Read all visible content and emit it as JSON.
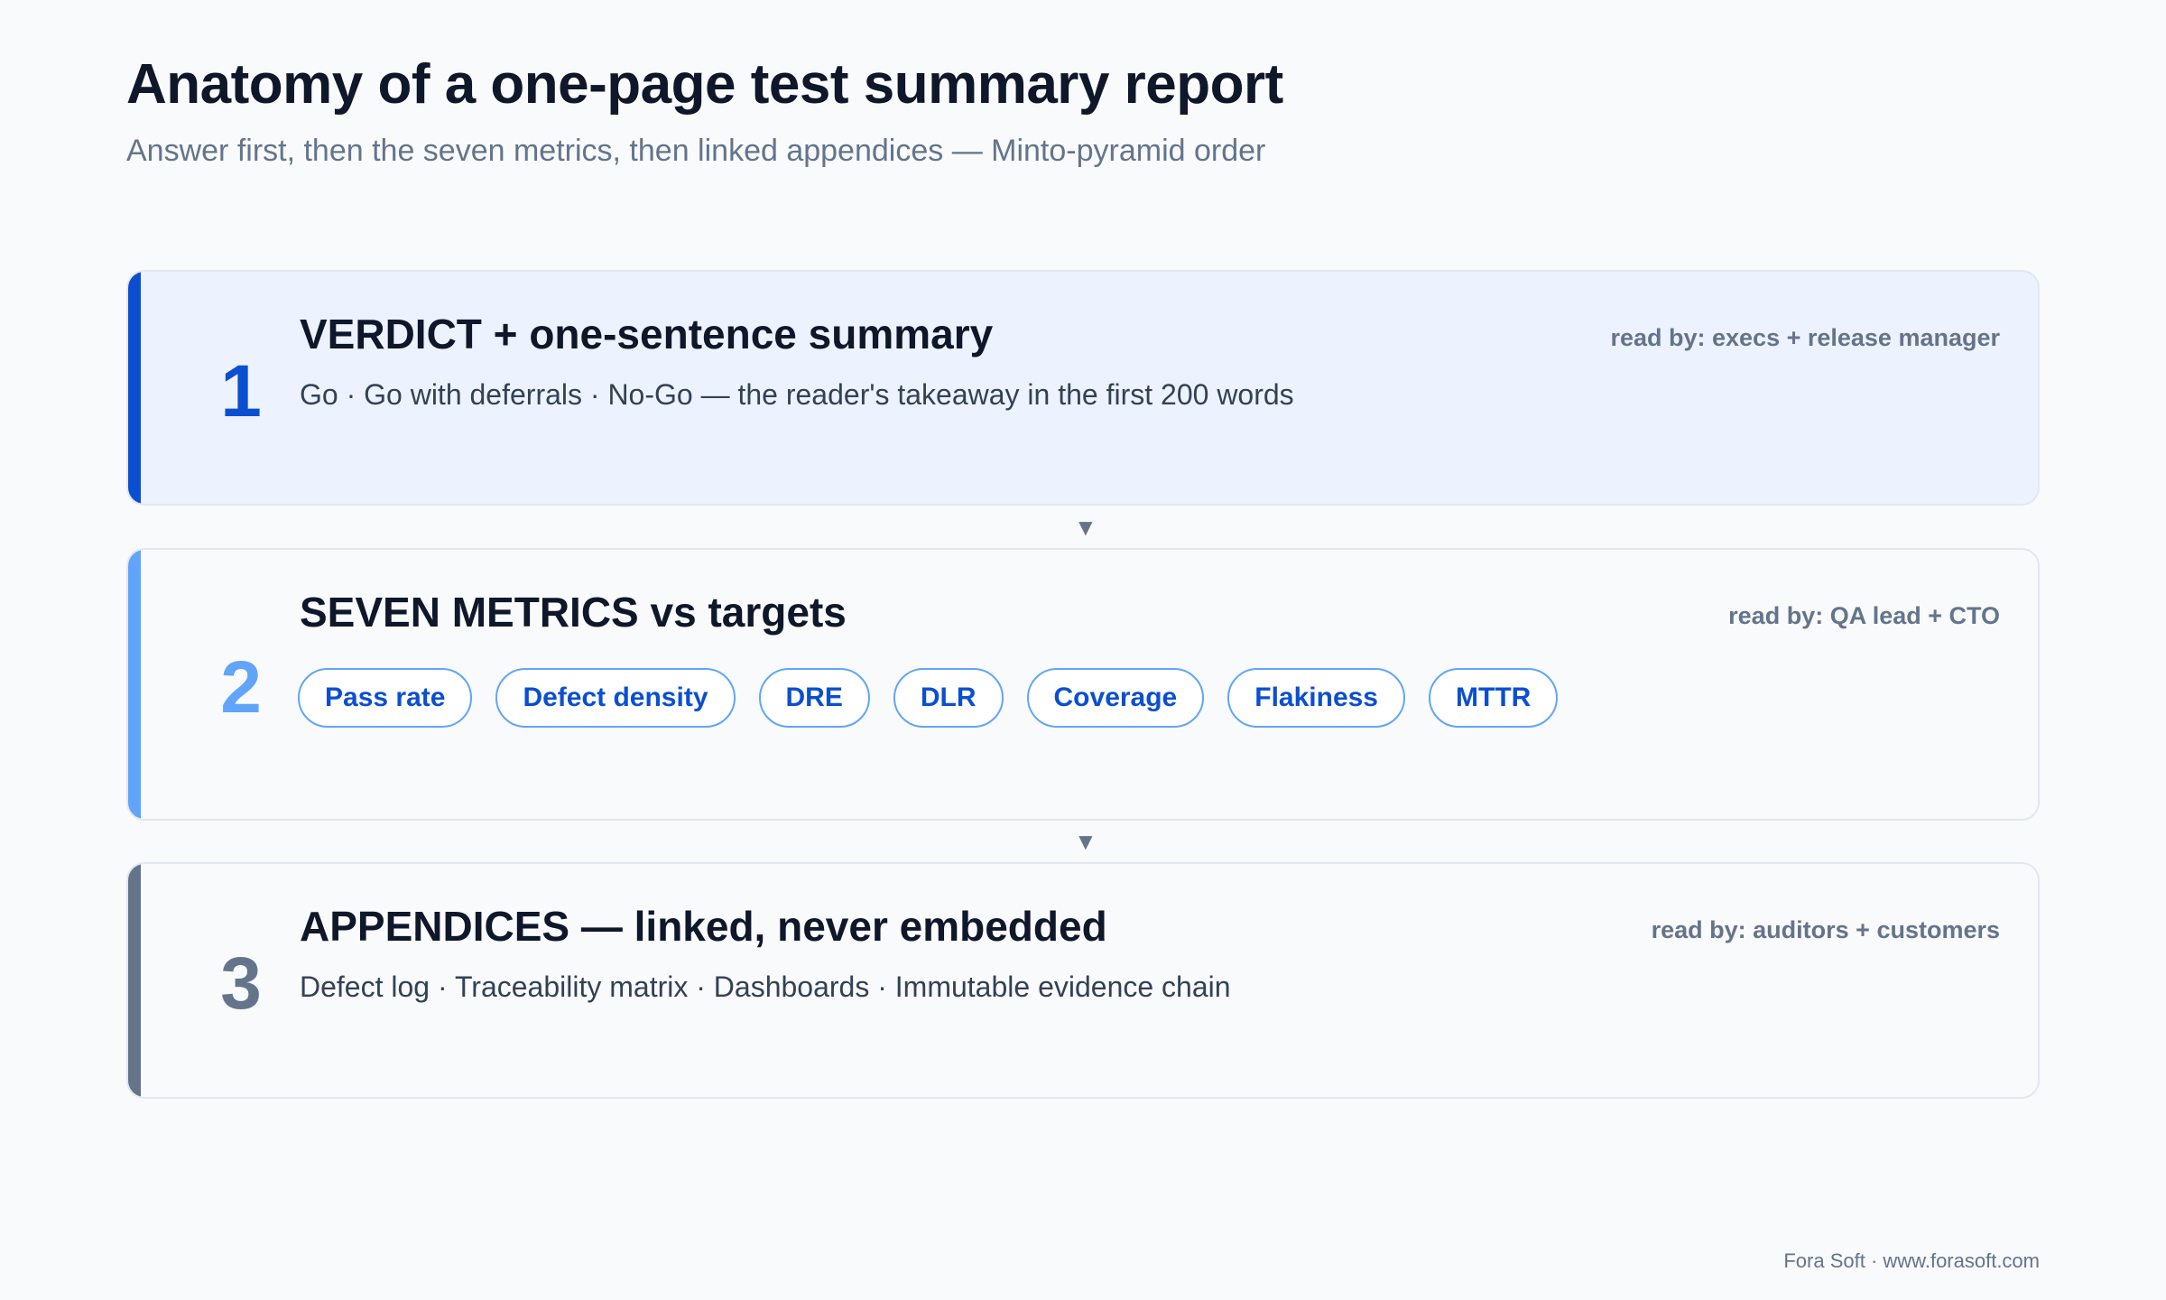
{
  "title": "Anatomy of a one-page test summary report",
  "subtitle": "Answer first, then the seven metrics, then linked appendices — Minto-pyramid order",
  "sections": [
    {
      "number": "1",
      "heading": "VERDICT + one-sentence summary",
      "read_by": "read by: execs + release manager",
      "description": "Go · Go with deferrals · No-Go — the reader's takeaway in the first 200 words",
      "accent_color": "#0b4fd1"
    },
    {
      "number": "2",
      "heading": "SEVEN METRICS vs targets",
      "read_by": "read by: QA lead + CTO",
      "metrics": [
        "Pass rate",
        "Defect density",
        "DRE",
        "DLR",
        "Coverage",
        "Flakiness",
        "MTTR"
      ],
      "accent_color": "#60a5fa"
    },
    {
      "number": "3",
      "heading": "APPENDICES — linked, never embedded",
      "read_by": "read by: auditors + customers",
      "description": "Defect log · Traceability matrix · Dashboards · Immutable evidence chain",
      "accent_color": "#64748b"
    }
  ],
  "arrow_glyph": "▼",
  "footer": "Fora Soft · www.forasoft.com"
}
